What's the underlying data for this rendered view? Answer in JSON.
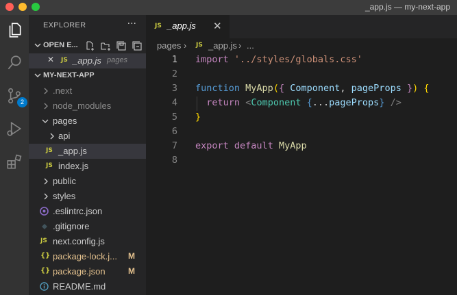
{
  "window": {
    "title": "_app.js — my-next-app"
  },
  "activity_bar": {
    "items": [
      {
        "name": "explorer-icon"
      },
      {
        "name": "search-icon"
      },
      {
        "name": "source-control-icon",
        "badge": "2"
      },
      {
        "name": "run-debug-icon"
      },
      {
        "name": "extensions-icon"
      }
    ]
  },
  "sidebar": {
    "title": "EXPLORER",
    "more": "···",
    "open_editors": {
      "label": "OPEN E...",
      "items": [
        {
          "close": "✕",
          "icon": "JS",
          "name": "_app.js",
          "folder": "pages"
        }
      ]
    },
    "project": {
      "label": "MY-NEXT-APP",
      "items": [
        {
          "type": "folder",
          "chevron": "›",
          "name": ".next",
          "dim": true
        },
        {
          "type": "folder",
          "chevron": "›",
          "name": "node_modules",
          "dim": true
        },
        {
          "type": "folder",
          "chevron": "⌄",
          "name": "pages"
        },
        {
          "type": "folder",
          "chevron": "›",
          "name": "api"
        },
        {
          "type": "file",
          "icon": "JS",
          "name": "_app.js",
          "selected": true
        },
        {
          "type": "file",
          "icon": "JS",
          "name": "index.js"
        },
        {
          "type": "folder",
          "chevron": "›",
          "name": "public"
        },
        {
          "type": "folder",
          "chevron": "›",
          "name": "styles"
        },
        {
          "type": "file",
          "icon": "eslint",
          "name": ".eslintrc.json"
        },
        {
          "type": "file",
          "icon": "git",
          "name": ".gitignore"
        },
        {
          "type": "file",
          "icon": "JS",
          "name": "next.config.js"
        },
        {
          "type": "file",
          "icon": "{}",
          "name": "package-lock.j...",
          "status": "M"
        },
        {
          "type": "file",
          "icon": "{}",
          "name": "package.json",
          "status": "M"
        },
        {
          "type": "file",
          "icon": "info",
          "name": "README.md"
        }
      ]
    }
  },
  "tabs": [
    {
      "icon": "JS",
      "label": "_app.js",
      "close": "✕"
    }
  ],
  "breadcrumb": {
    "folder": "pages",
    "separator": "›",
    "icon": "JS",
    "file": "_app.js",
    "ellipsis": "..."
  },
  "editor": {
    "current_line": 1,
    "lines": [
      {
        "n": "1"
      },
      {
        "n": "2"
      },
      {
        "n": "3"
      },
      {
        "n": "4"
      },
      {
        "n": "5"
      },
      {
        "n": "6"
      },
      {
        "n": "7"
      },
      {
        "n": "8"
      }
    ],
    "tokens": {
      "l1": {
        "kw": "import",
        "str": "'../styles/globals.css'"
      },
      "l3": {
        "kw": "function",
        "fn": "MyApp",
        "open": "(",
        "brace_open": "{",
        "p1": "Component",
        "comma": ",",
        "p2": "pageProps",
        "brace_close": "}",
        "close": ")",
        "body_open": "{"
      },
      "l4": {
        "kw": "return",
        "lt": "<",
        "tag": "Component",
        "attr_open": "{",
        "spread": "...",
        "var": "pageProps",
        "attr_close": "}",
        "end": "/>"
      },
      "l5": {
        "body_close": "}"
      },
      "l7": {
        "kw1": "export",
        "kw2": "default",
        "fn": "MyApp"
      }
    }
  },
  "colors": {
    "editor_bg": "#1e1e1e",
    "sidebar_bg": "#252526",
    "activity_bg": "#333333",
    "titlebar_bg": "#3c3c3c",
    "accent": "#007acc",
    "keyword": "#c586c0",
    "string": "#ce9178",
    "function": "#dcdcaa",
    "variable": "#9cdcfe",
    "component": "#4ec9b0",
    "modified": "#e2c08d"
  }
}
